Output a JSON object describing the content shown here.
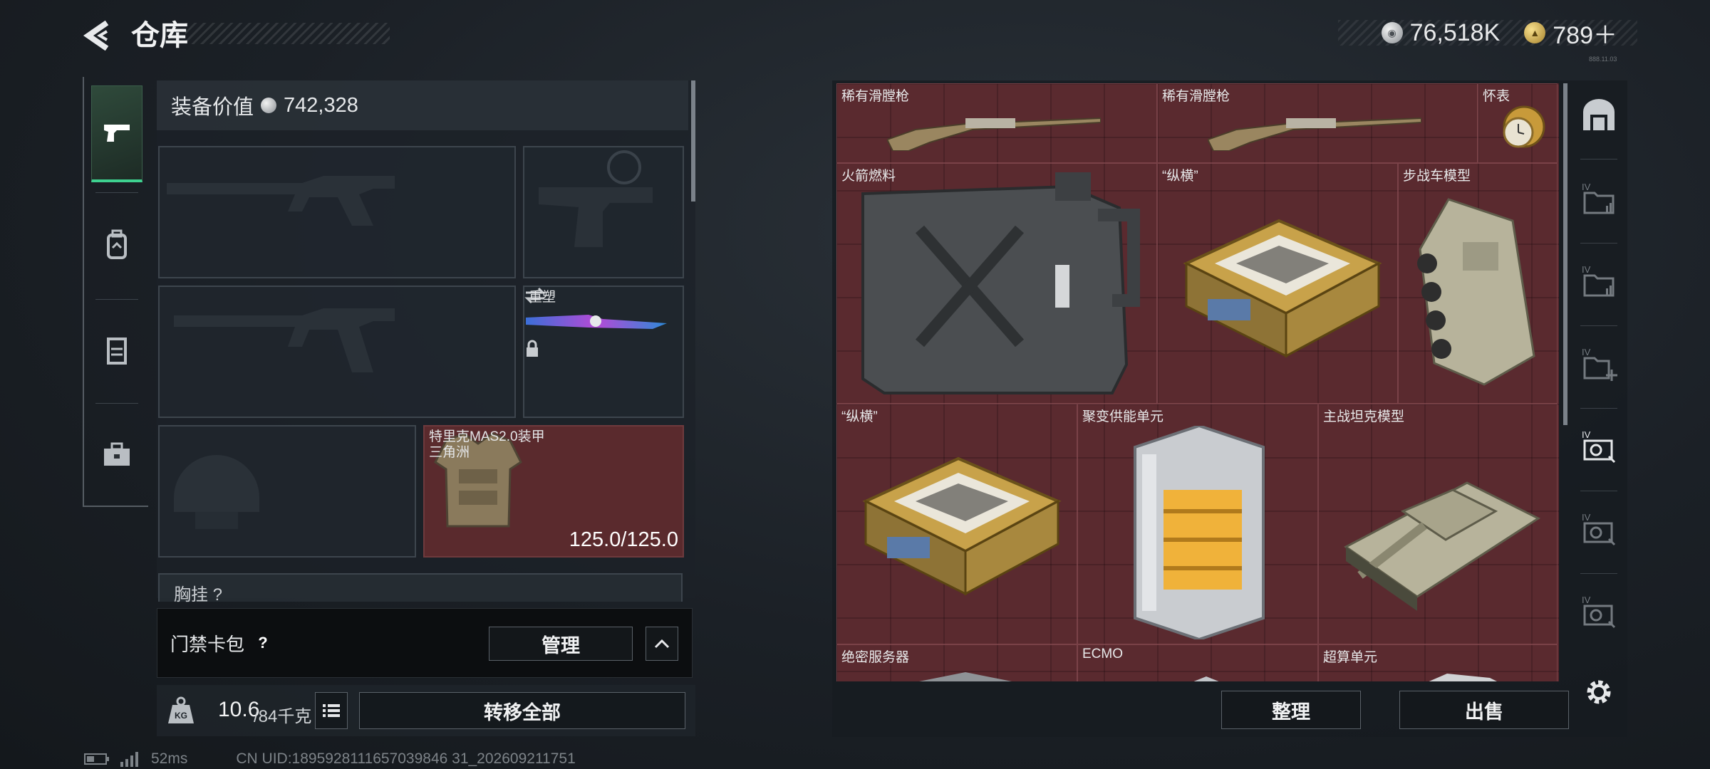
{
  "header": {
    "title": "仓库",
    "currency_silver": "76,518K",
    "currency_gold": "789＋",
    "tiny_text": "888.11.03"
  },
  "equipment": {
    "value_label": "装备价值",
    "value": "742,328",
    "melee_label": "重塑",
    "armor_name_line1": "特里克MAS2.0装甲",
    "armor_name_line2": "三角洲",
    "armor_durability": "125.0/125.0",
    "chest_label": "胸挂 ?"
  },
  "keycard": {
    "label": "门禁卡包",
    "help": "?",
    "manage_label": "管理"
  },
  "weight": {
    "current": "10.6",
    "max": "/84千克",
    "kg_badge": "KG"
  },
  "actions": {
    "transfer_all": "转移全部",
    "sort": "整理",
    "sell": "出售"
  },
  "status": {
    "ping": "52ms",
    "uid": "CN UID:1895928111657039846 31_202609211751"
  },
  "stash_items": [
    {
      "label": "稀有滑膛枪"
    },
    {
      "label": "稀有滑膛枪"
    },
    {
      "label": "怀表"
    },
    {
      "label": "火箭燃料"
    },
    {
      "label": "“纵横”"
    },
    {
      "label": "步战车模型"
    },
    {
      "label": "“纵横”"
    },
    {
      "label": "聚变供能单元"
    },
    {
      "label": "主战坦克模型"
    },
    {
      "label": "绝密服务器"
    },
    {
      "label": "ECMO"
    },
    {
      "label": "超算单元"
    }
  ],
  "stash_tabs": [
    "IV",
    "IV",
    "IV",
    "IV",
    "IV",
    "IV"
  ]
}
